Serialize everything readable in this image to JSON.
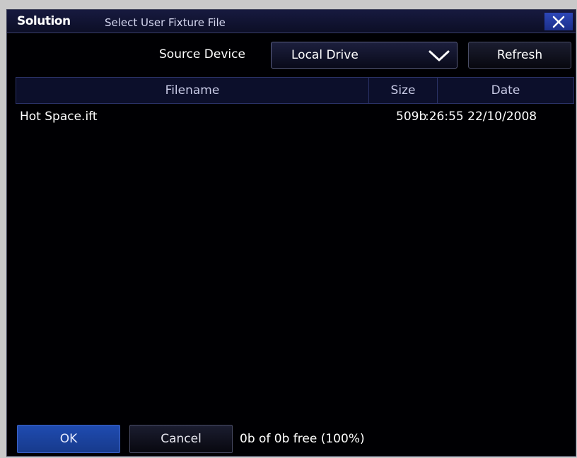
{
  "window": {
    "brand": "Solution",
    "title": "Select User Fixture File",
    "close_icon": "close-icon"
  },
  "toolbar": {
    "source_label": "Source Device",
    "source_value": "Local Drive",
    "dropdown_icon": "chevron-down-icon",
    "refresh_label": "Refresh"
  },
  "table": {
    "columns": [
      "Filename",
      "Size",
      "Date"
    ],
    "rows": [
      {
        "filename": "Hot Space.ift",
        "size": "509b",
        "date": ":26:55 22/10/2008"
      }
    ]
  },
  "footer": {
    "ok_label": "OK",
    "cancel_label": "Cancel",
    "status": "0b of 0b free (100%)"
  },
  "colors": {
    "background": "#000003",
    "accent": "#1f4bb0",
    "header": "#0c0f2b"
  }
}
